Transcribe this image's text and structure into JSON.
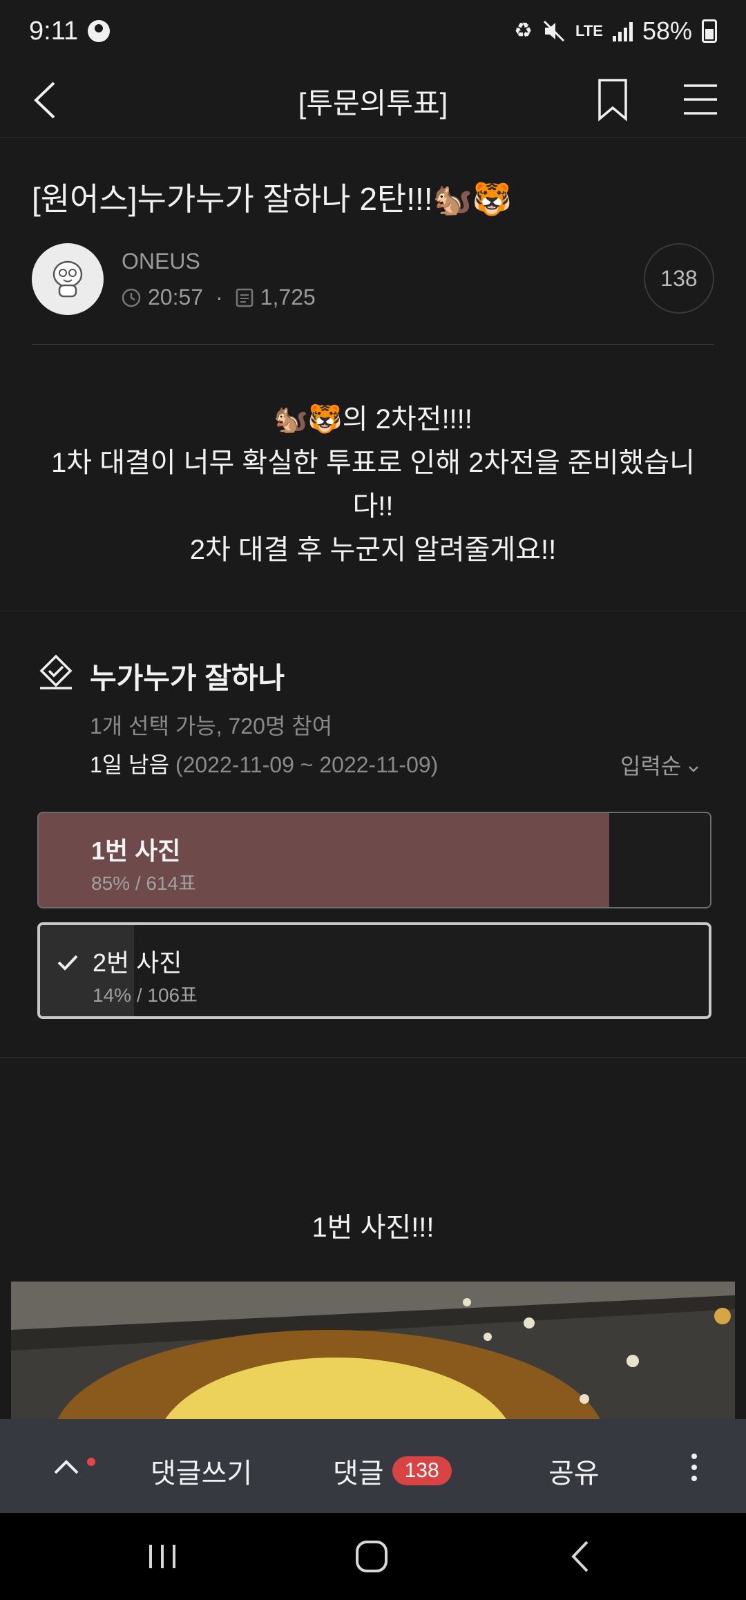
{
  "status_bar": {
    "time": "9:11",
    "network": "LTE",
    "battery": "58%"
  },
  "app_bar": {
    "title": "[투문의투표]"
  },
  "post": {
    "title": "[원어스]누가누가 잘하나 2탄!!!🐿️🐯",
    "author": "ONEUS",
    "time": "20:57",
    "views": "1,725",
    "comment_count": "138",
    "body_lines": [
      "🐿️🐯의 2차전!!!!",
      "1차 대결이 너무 확실한 투표로 인해 2차전을 준비했습니",
      "다!!",
      "2차 대결 후 누군지 알려줄게요!!"
    ]
  },
  "poll": {
    "title": "누가누가 잘하나",
    "meta": "1개 선택 가능, 720명 참여",
    "remaining": "1일 남음",
    "date_range": "(2022-11-09 ~ 2022-11-09)",
    "sort_label": "입력순",
    "options": [
      {
        "label": "1번 사진",
        "stats": "85% / 614표",
        "percent": 85,
        "selected": false
      },
      {
        "label": "2번 사진",
        "stats": "14% / 106표",
        "percent": 14,
        "selected": true
      }
    ]
  },
  "content": {
    "image_caption": "1번 사진!!!"
  },
  "action_bar": {
    "write_label": "댓글쓰기",
    "comments_label": "댓글",
    "comments_badge": "138",
    "share_label": "공유"
  },
  "icons": {
    "back": "chevron-left-icon",
    "bookmark": "bookmark-icon",
    "menu": "hamburger-menu-icon",
    "poll": "poll-check-icon",
    "check": "check-icon",
    "scroll_up": "chevron-up-icon",
    "more": "more-vertical-icon"
  },
  "colors": {
    "background": "#1a1a1a",
    "winning_bar": "#6e4a4b",
    "badge": "#d94343",
    "action_bar": "#373940"
  }
}
